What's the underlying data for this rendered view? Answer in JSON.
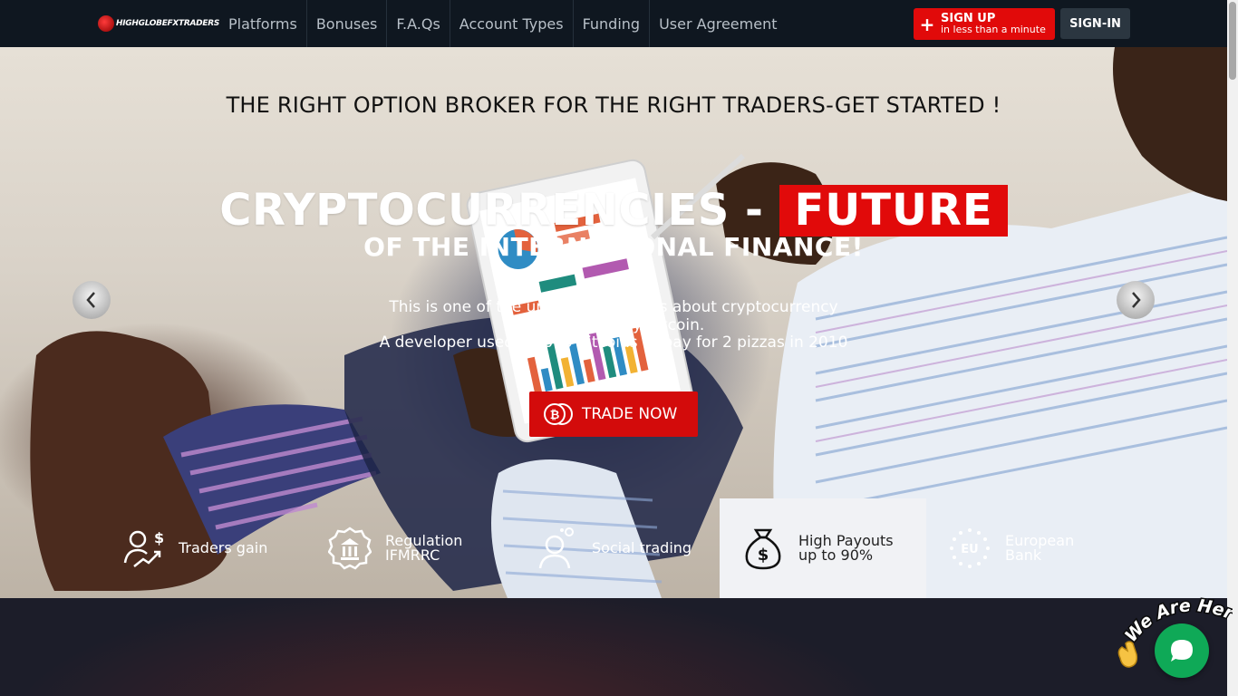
{
  "nav": {
    "logo_text": "HIGHGLOBEFXTRADERS",
    "links": [
      "Platforms",
      "Bonuses",
      "F.A.Qs",
      "Account Types",
      "Funding",
      "User Agreement"
    ],
    "signup_title": "SIGN UP",
    "signup_subtitle": "in less than a minute",
    "signin_label": "SIGN-IN"
  },
  "hero": {
    "heading": "THE RIGHT OPTION BROKER FOR THE RIGHT TRADERS-GET STARTED !",
    "headline_main": "CRYPTOCURRENCIES -",
    "headline_highlight": "FUTURE",
    "subheadline": "OF THE INTERNATIONAL FINANCE!",
    "description": [
      "This is one of the unbelievable facts about cryptocurrency",
      "and specifically Bitcoin.",
      "A developer used 10,000 bitcoins to pay for 2 pizzas in 2010"
    ],
    "cta_label": "TRADE NOW",
    "cta_icon": "bitcoin-coins-icon",
    "prev_icon": "chevron-left-icon",
    "next_icon": "chevron-right-icon"
  },
  "features": [
    {
      "icon": "traders-gain-icon",
      "label": "Traders gain",
      "active": false
    },
    {
      "icon": "bank-building-icon",
      "label": "Regulation\nIFMRRC",
      "active": false
    },
    {
      "icon": "social-trading-icon",
      "label": "Social trading",
      "active": false
    },
    {
      "icon": "money-bag-icon",
      "label": "High Payouts\nup to 90%",
      "active": true
    },
    {
      "icon": "eu-stars-icon",
      "label": "European\nBank",
      "active": false
    }
  ],
  "chat": {
    "badge_text": "We Are Here!",
    "icon": "chat-bubble-icon"
  },
  "colors": {
    "accent_red": "#e10a0a",
    "nav_bg": "#0f1720",
    "chat_green": "#0fa957"
  }
}
